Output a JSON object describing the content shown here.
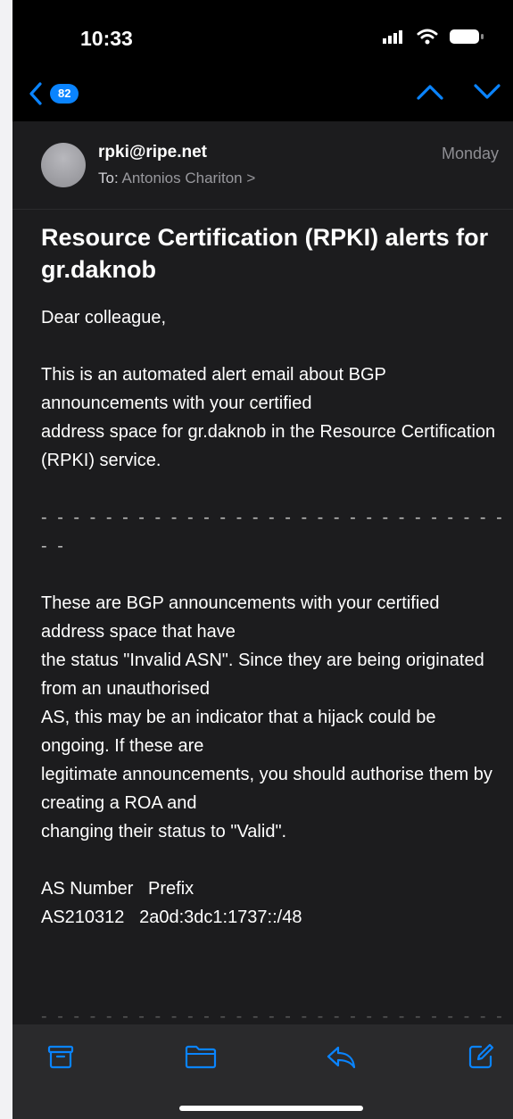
{
  "status_bar": {
    "time": "10:33"
  },
  "nav": {
    "unread_count": "82"
  },
  "message": {
    "sender": "rpki@ripe.net",
    "to_label": "To:",
    "recipient": "Antonios Chariton >",
    "date": "Monday",
    "subject": "Resource Certification (RPKI) alerts for gr.daknob",
    "greeting": "Dear colleague,",
    "intro": "This is an automated alert email about BGP announcements with your certified\naddress space for gr.daknob in the Resource Certification (RPKI) service.",
    "separator": "- - - - - - - - - - - - - - - - - - - - - - - - - - - - - - -",
    "body_paragraph": "These are BGP announcements with your certified address space that have\nthe status \"Invalid ASN\". Since they are being originated from an unauthorised\nAS, this may be an indicator that a hijack could be ongoing. If these are\nlegitimate announcements, you should authorise them by creating a ROA and\nchanging their status to \"Valid\".",
    "table_header": "AS Number   Prefix",
    "table_row": "AS210312   2a0d:3dc1:1737::/48"
  },
  "toolbar": {
    "archive": "archive-icon",
    "move": "folder-icon",
    "reply": "reply-icon",
    "compose": "compose-icon"
  },
  "colors": {
    "accent": "#0a84ff",
    "background": "#1c1c1e"
  }
}
